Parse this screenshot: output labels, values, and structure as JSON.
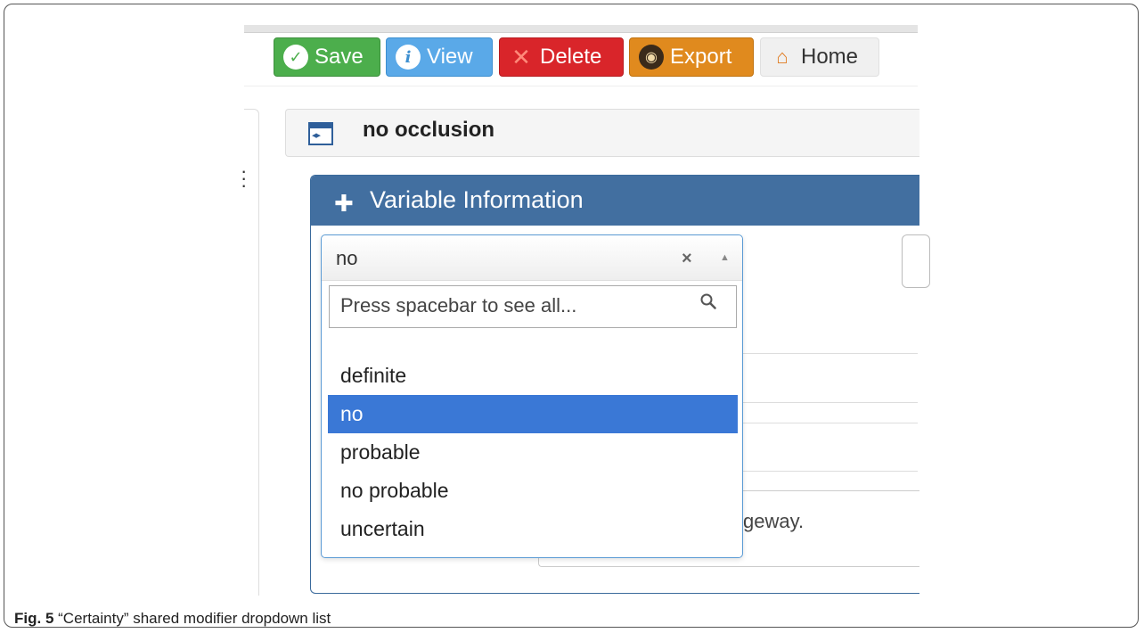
{
  "toolbar": {
    "save_label": "Save",
    "view_label": "View",
    "delete_label": "Delete",
    "export_label": "Export",
    "home_label": "Home"
  },
  "panel": {
    "title": "no occlusion"
  },
  "variable_panel": {
    "title": "Variable Information"
  },
  "dropdown": {
    "selected_value": "no",
    "search_placeholder": "Press spacebar to see all...",
    "options": [
      "definite",
      "no",
      "probable",
      "no probable",
      "uncertain"
    ],
    "highlighted_index": 1
  },
  "background_text": "geway.",
  "caption": {
    "label": "Fig. 5",
    "text": "“Certainty” shared modifier dropdown list"
  },
  "colors": {
    "save": "#4cae4c",
    "view": "#5aa9e8",
    "delete": "#d9252a",
    "export": "#e08a1e",
    "header": "#426fa0",
    "highlight": "#3a78d6"
  },
  "icons": [
    "check-circle-icon",
    "info-icon",
    "x-icon",
    "owl-icon",
    "home-icon",
    "panel-toggle-icon",
    "puzzle-icon",
    "clear-icon",
    "chevron-up-icon",
    "search-icon",
    "kebab-menu-icon"
  ]
}
